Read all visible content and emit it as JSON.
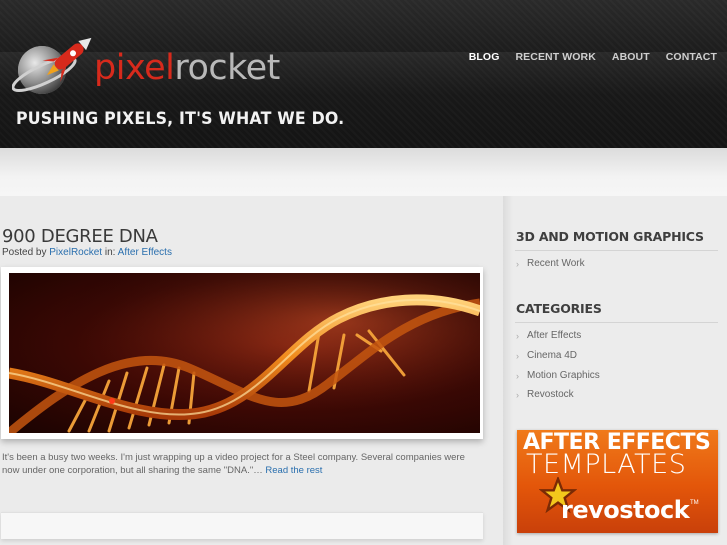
{
  "site": {
    "logo_part1": "pixel",
    "logo_part2": "rocket",
    "tagline": "PUSHING PIXELS, IT'S WHAT WE DO."
  },
  "nav": [
    {
      "label": "BLOG",
      "active": true
    },
    {
      "label": "RECENT WORK",
      "active": false
    },
    {
      "label": "ABOUT",
      "active": false
    },
    {
      "label": "CONTACT",
      "active": false
    }
  ],
  "post": {
    "title": "900 DEGREE DNA",
    "meta_posted_by": "Posted by",
    "author": "PixelRocket",
    "meta_in": "in:",
    "category": "After Effects",
    "excerpt": "It's been a busy two weeks.  I'm just wrapping up a video project for a Steel company.  Several companies were now under one corporation, but all sharing the same \"DNA.\"…",
    "read_more": "Read the rest"
  },
  "sidebar": {
    "section1_title": "3D AND MOTION GRAPHICS",
    "section1_items": [
      "Recent Work"
    ],
    "section2_title": "CATEGORIES",
    "section2_items": [
      "After Effects",
      "Cinema 4D",
      "Motion Graphics",
      "Revostock"
    ],
    "ad": {
      "line1": "AFTER EFFECTS",
      "line2": "TEMPLATES",
      "brand": "revostock",
      "trademark": "TM"
    }
  },
  "colors": {
    "accent_red": "#d72a1c",
    "link_blue": "#2a6fae",
    "ad_orange": "#e3560a"
  }
}
